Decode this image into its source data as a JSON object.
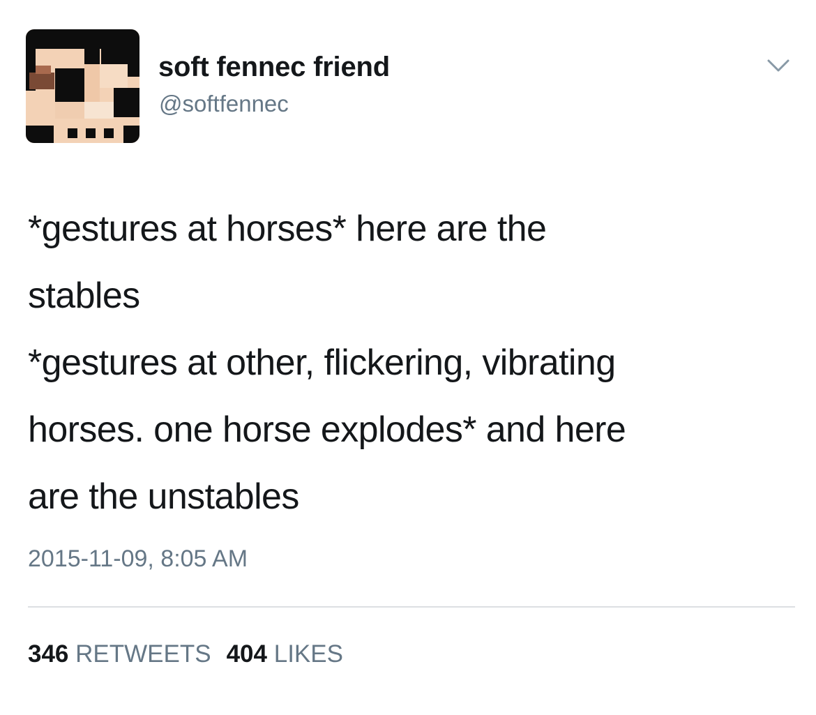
{
  "user": {
    "display_name": "soft fennec friend",
    "handle": "@softfennec"
  },
  "tweet": {
    "lines": [
      "*gestures at horses* here are the",
      "stables",
      "*gestures at other, flickering, vibrating",
      "horses. one horse explodes* and here",
      "are the unstables"
    ],
    "timestamp": "2015-11-09, 8:05 AM"
  },
  "stats": {
    "retweets_count": "346",
    "retweets_label": "RETWEETS",
    "likes_count": "404",
    "likes_label": "LIKES"
  },
  "icons": {
    "menu": "chevron-down-icon"
  },
  "colors": {
    "text": "#14171a",
    "secondary": "#657786",
    "divider": "#dcdfe2"
  }
}
